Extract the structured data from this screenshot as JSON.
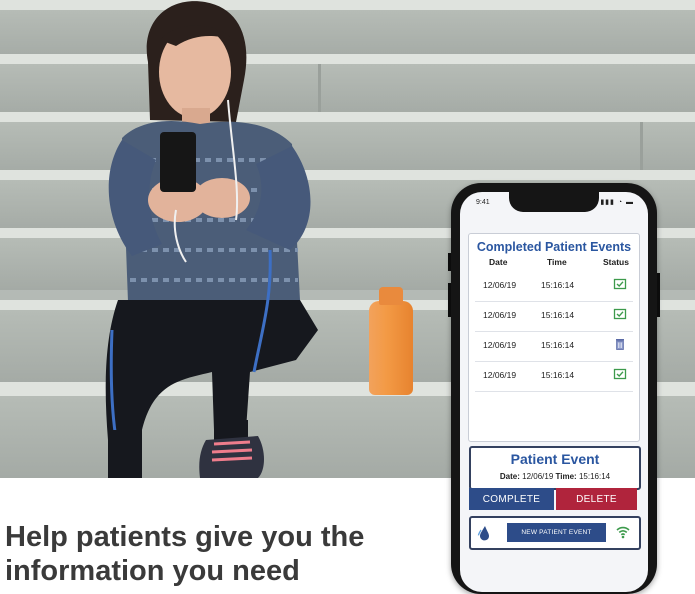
{
  "headline": "Help patients give you the information you need",
  "phone": {
    "status_time": "9:41",
    "completed_title": "Completed Patient Events",
    "columns": {
      "date": "Date",
      "time": "Time",
      "status": "Status"
    },
    "rows": [
      {
        "date": "12/06/19",
        "time": "15:16:14",
        "status_icon": "envelope-check-icon"
      },
      {
        "date": "12/06/19",
        "time": "15:16:14",
        "status_icon": "envelope-check-icon"
      },
      {
        "date": "12/06/19",
        "time": "15:16:14",
        "status_icon": "trash-icon"
      },
      {
        "date": "12/06/19",
        "time": "15:16:14",
        "status_icon": "envelope-check-icon"
      }
    ],
    "patient_event": {
      "title": "Patient Event",
      "date_label": "Date:",
      "date_value": "12/06/19",
      "time_label": "Time:",
      "time_value": "15:16:14"
    },
    "buttons": {
      "complete": "COMPLETE",
      "delete": "DELETE",
      "new_event": "NEW PATIENT EVENT"
    },
    "icons": {
      "left": "drop-icon",
      "right": "wifi-icon"
    }
  },
  "colors": {
    "accent_blue": "#2a56a0",
    "button_blue": "#2d4c89",
    "delete_red": "#b0243c",
    "status_green": "#3d9a4c"
  }
}
